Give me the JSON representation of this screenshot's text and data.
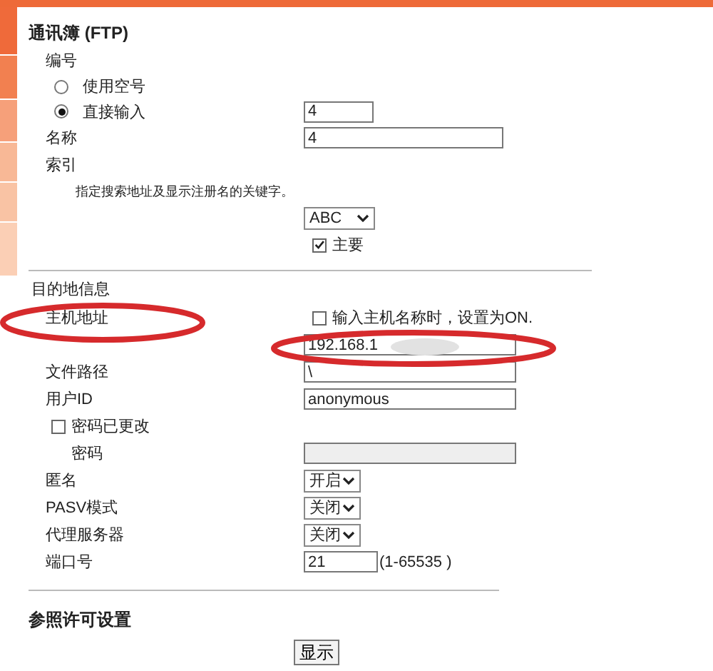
{
  "section_title": "通讯簿 (FTP)",
  "number": {
    "label": "编号",
    "options": [
      {
        "label": "使用空号",
        "selected": false
      },
      {
        "label": "直接输入",
        "selected": true
      }
    ],
    "value": "4"
  },
  "name": {
    "label": "名称",
    "value": "4"
  },
  "index": {
    "label": "索引",
    "hint": "指定搜索地址及显示注册名的关键字。",
    "select": "ABC",
    "primary": {
      "label": "主要",
      "checked": true
    }
  },
  "destination": {
    "title": "目的地信息",
    "host": {
      "label": "主机地址",
      "checkbox": {
        "label": "输入主机名称时，设置为ON.",
        "checked": false
      },
      "value": "192.168.1"
    },
    "path": {
      "label": "文件路径",
      "value": "\\"
    },
    "user_id": {
      "label": "用户ID",
      "value": "anonymous"
    },
    "password_changed": {
      "label": "密码已更改",
      "checked": false
    },
    "password": {
      "label": "密码",
      "disabled": true
    },
    "selects": [
      {
        "label": "匿名",
        "value": "开启"
      },
      {
        "label": "PASV模式",
        "value": "关闭"
      },
      {
        "label": "代理服务器",
        "value": "关闭"
      }
    ],
    "port": {
      "label": "端口号",
      "value": "21",
      "range": "(1-65535 )"
    }
  },
  "reference": {
    "title": "参照许可设置",
    "button": "显示"
  }
}
